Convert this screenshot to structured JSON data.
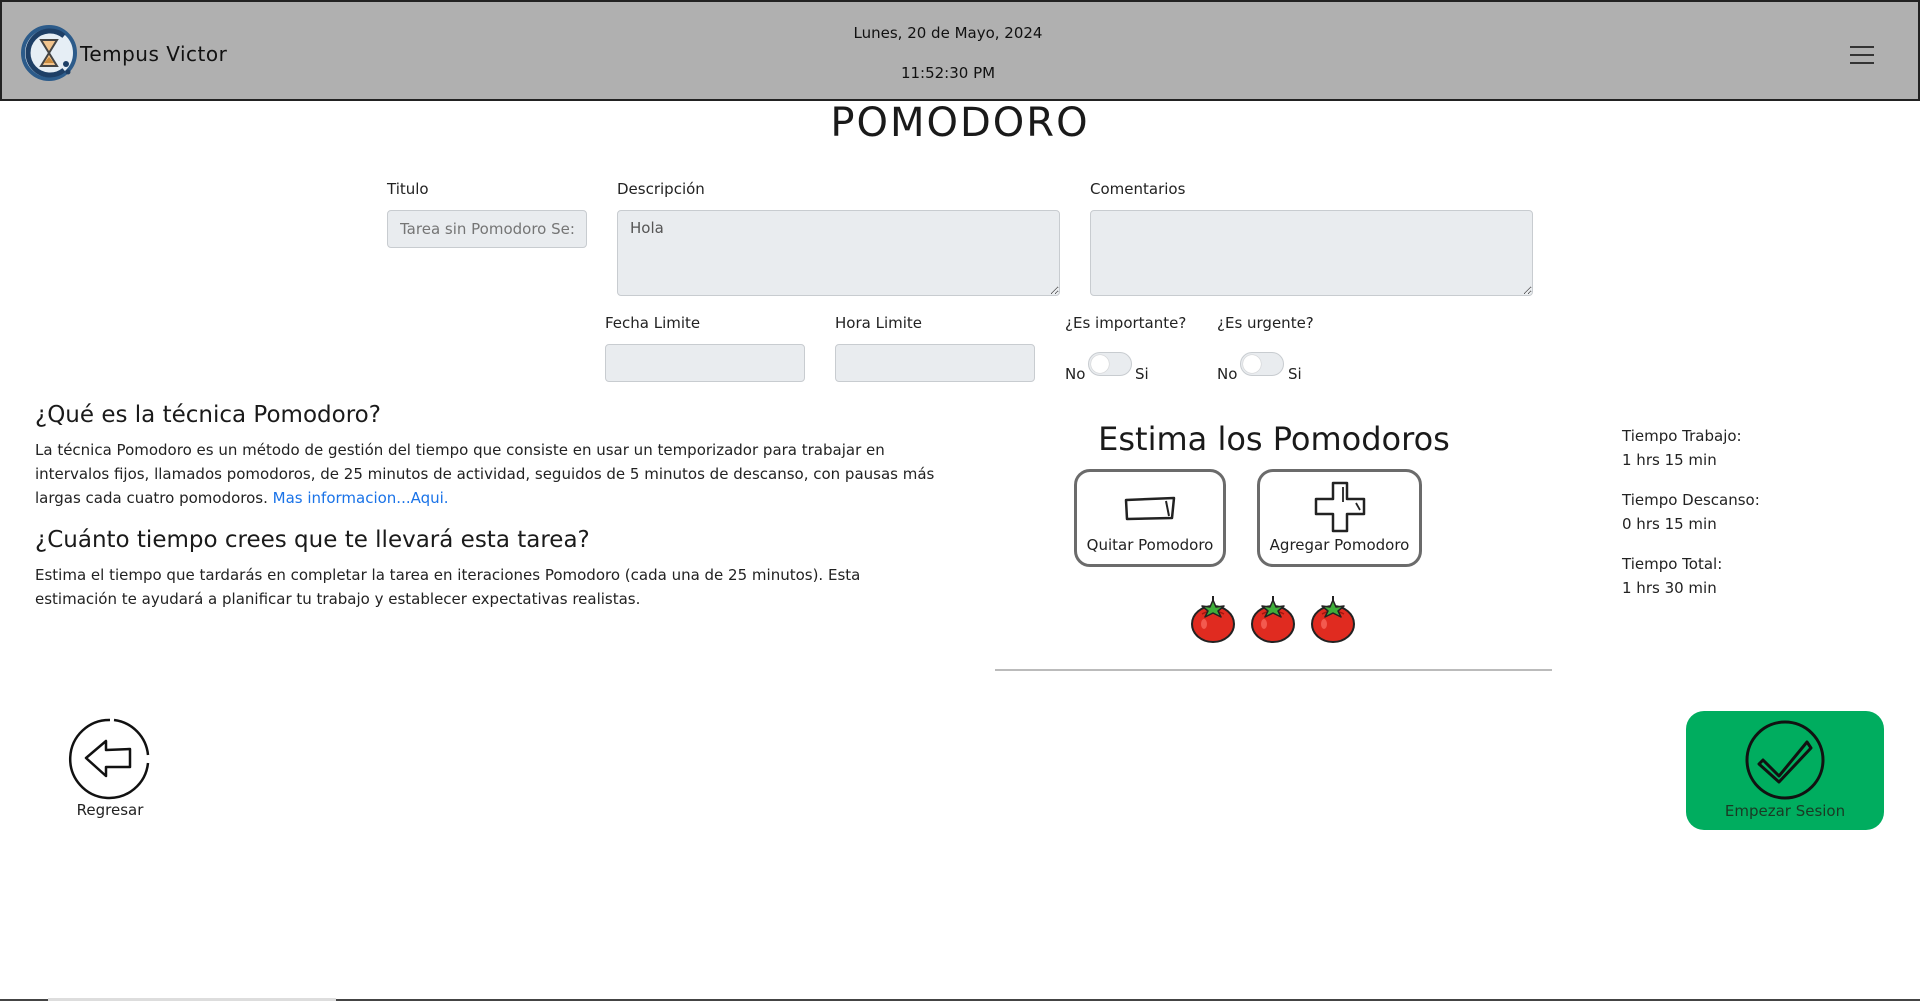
{
  "header": {
    "brand": "Tempus Victor",
    "date": "Lunes, 20 de Mayo, 2024",
    "time": "11:52:30 PM",
    "menu_icon": "hamburger-icon"
  },
  "page_title": "POMODORO",
  "form": {
    "titulo_label": "Titulo",
    "titulo_placeholder": "Tarea sin Pomodoro Se:",
    "descripcion_label": "Descripción",
    "descripcion_value": "Hola",
    "comentarios_label": "Comentarios",
    "comentarios_value": "",
    "fecha_label": "Fecha Limite",
    "fecha_value": "",
    "hora_label": "Hora Limite",
    "hora_value": "",
    "importante_label": "¿Es importante?",
    "urgente_label": "¿Es urgente?",
    "no_label": "No",
    "si_label": "Si"
  },
  "info": {
    "q1": "¿Qué es la técnica Pomodoro?",
    "p1": "La técnica Pomodoro es un método de gestión del tiempo que consiste en usar un temporizador para trabajar en intervalos fijos, llamados pomodoros, de 25 minutos de actividad, seguidos de 5 minutos de descanso, con pausas más largas cada cuatro pomodoros.",
    "p1_link": "Mas informacion...Aqui.",
    "q2": "¿Cuánto tiempo crees que te llevará esta tarea?",
    "p2": "Estima el tiempo que tardarás en completar la tarea en iteraciones Pomodoro (cada una de 25 minutos). Esta estimación te ayudará a planificar tu trabajo y establecer expectativas realistas."
  },
  "estimate": {
    "title": "Estima los Pomodoros",
    "remove_label": "Quitar Pomodoro",
    "add_label": "Agregar Pomodoro",
    "pomodoro_count": 3,
    "tomato_color": "#e02b20"
  },
  "times": {
    "trabajo_label": "Tiempo Trabajo:",
    "trabajo_value": "1 hrs 15 min",
    "descanso_label": "Tiempo Descanso:",
    "descanso_value": "0 hrs 15 min",
    "total_label": "Tiempo Total:",
    "total_value": "1 hrs 30 min"
  },
  "actions": {
    "back_label": "Regresar",
    "start_label": "Empezar Sesion",
    "start_color": "#00ad5f"
  }
}
